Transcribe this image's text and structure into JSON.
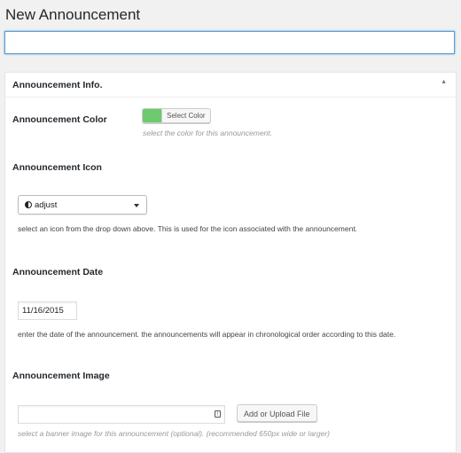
{
  "page": {
    "title": "New Announcement"
  },
  "title_input": {
    "value": "",
    "placeholder": ""
  },
  "metabox": {
    "title": "Announcement Info.",
    "toggle_icon": "triangle-up-icon"
  },
  "color": {
    "label": "Announcement Color",
    "swatch_color": "#6ccb6c",
    "button_label": "Select Color",
    "description": "select the color for this announcement."
  },
  "icon": {
    "label": "Announcement Icon",
    "selected_icon": "adjust-icon",
    "selected_value": "adjust",
    "description": "select an icon from the drop down above. This is used for the icon associated with the announcement."
  },
  "date": {
    "label": "Announcement Date",
    "value": "11/16/2015",
    "description": "enter the date of the announcement. the announcements will appear in chronological order according to this date."
  },
  "image": {
    "label": "Announcement Image",
    "value": "",
    "field_icon": "file-icon",
    "button_label": "Add or Upload File",
    "description": "select a banner image for this announcement (optional). (recommended 650px wide or larger)"
  }
}
